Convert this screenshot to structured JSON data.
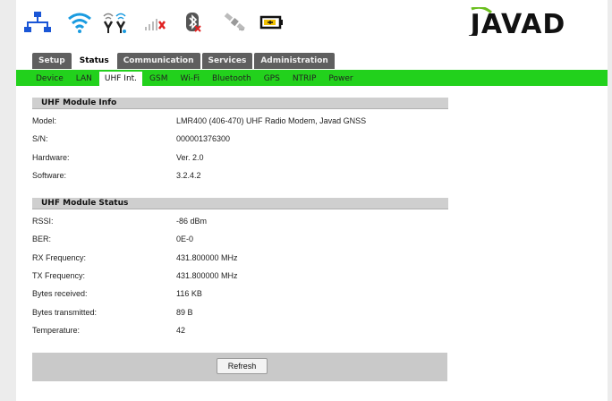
{
  "header": {
    "icons": [
      "lan-icon",
      "wifi-icon",
      "radio-antenna-icon",
      "cellular-signal-icon",
      "bluetooth-icon",
      "satellite-icon",
      "battery-icon"
    ],
    "logo_text": "JAVAD",
    "colors": {
      "lan": "#1a56d6",
      "wifi": "#1a9be0",
      "logo": "#111111",
      "logo_swoosh": "#6bbf1f"
    }
  },
  "main_tabs": [
    {
      "label": "Setup",
      "active": false
    },
    {
      "label": "Status",
      "active": true
    },
    {
      "label": "Communication",
      "active": false
    },
    {
      "label": "Services",
      "active": false
    },
    {
      "label": "Administration",
      "active": false
    }
  ],
  "sub_tabs": [
    {
      "label": "Device",
      "active": false
    },
    {
      "label": "LAN",
      "active": false
    },
    {
      "label": "UHF Int.",
      "active": true
    },
    {
      "label": "GSM",
      "active": false
    },
    {
      "label": "Wi-Fi",
      "active": false
    },
    {
      "label": "Bluetooth",
      "active": false
    },
    {
      "label": "GPS",
      "active": false
    },
    {
      "label": "NTRIP",
      "active": false
    },
    {
      "label": "Power",
      "active": false
    }
  ],
  "module_info": {
    "title": "UHF Module Info",
    "rows": [
      {
        "label": "Model:",
        "value": "LMR400 (406-470) UHF Radio Modem, Javad GNSS"
      },
      {
        "label": "S/N:",
        "value": "000001376300"
      },
      {
        "label": "Hardware:",
        "value": "Ver. 2.0"
      },
      {
        "label": "Software:",
        "value": "3.2.4.2"
      }
    ]
  },
  "module_status": {
    "title": "UHF Module Status",
    "rows": [
      {
        "label": "RSSI:",
        "value": "-86 dBm"
      },
      {
        "label": "BER:",
        "value": "0E-0"
      },
      {
        "label": "RX Frequency:",
        "value": "431.800000 MHz"
      },
      {
        "label": "TX Frequency:",
        "value": "431.800000 MHz"
      },
      {
        "label": "Bytes received:",
        "value": "116 KB"
      },
      {
        "label": "Bytes transmitted:",
        "value": "89 B"
      },
      {
        "label": "Temperature:",
        "value": "42"
      }
    ]
  },
  "refresh_label": "Refresh",
  "theme": {
    "green": "#22d11c",
    "tab_grey": "#5f5f5f",
    "section_grey": "#cfcfcf"
  }
}
